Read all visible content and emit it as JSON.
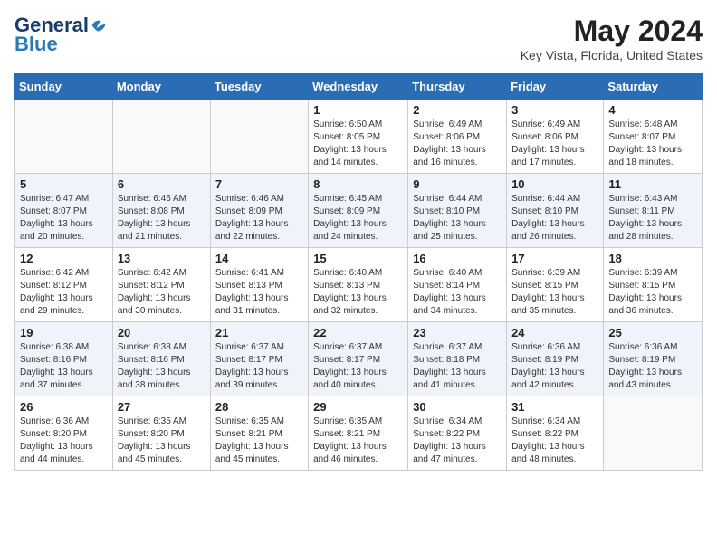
{
  "header": {
    "logo": {
      "general": "General",
      "blue": "Blue"
    },
    "title": "May 2024",
    "location": "Key Vista, Florida, United States"
  },
  "weekdays": [
    "Sunday",
    "Monday",
    "Tuesday",
    "Wednesday",
    "Thursday",
    "Friday",
    "Saturday"
  ],
  "weeks": [
    [
      {
        "day": "",
        "info": ""
      },
      {
        "day": "",
        "info": ""
      },
      {
        "day": "",
        "info": ""
      },
      {
        "day": "1",
        "info": "Sunrise: 6:50 AM\nSunset: 8:05 PM\nDaylight: 13 hours and 14 minutes."
      },
      {
        "day": "2",
        "info": "Sunrise: 6:49 AM\nSunset: 8:06 PM\nDaylight: 13 hours and 16 minutes."
      },
      {
        "day": "3",
        "info": "Sunrise: 6:49 AM\nSunset: 8:06 PM\nDaylight: 13 hours and 17 minutes."
      },
      {
        "day": "4",
        "info": "Sunrise: 6:48 AM\nSunset: 8:07 PM\nDaylight: 13 hours and 18 minutes."
      }
    ],
    [
      {
        "day": "5",
        "info": "Sunrise: 6:47 AM\nSunset: 8:07 PM\nDaylight: 13 hours and 20 minutes."
      },
      {
        "day": "6",
        "info": "Sunrise: 6:46 AM\nSunset: 8:08 PM\nDaylight: 13 hours and 21 minutes."
      },
      {
        "day": "7",
        "info": "Sunrise: 6:46 AM\nSunset: 8:09 PM\nDaylight: 13 hours and 22 minutes."
      },
      {
        "day": "8",
        "info": "Sunrise: 6:45 AM\nSunset: 8:09 PM\nDaylight: 13 hours and 24 minutes."
      },
      {
        "day": "9",
        "info": "Sunrise: 6:44 AM\nSunset: 8:10 PM\nDaylight: 13 hours and 25 minutes."
      },
      {
        "day": "10",
        "info": "Sunrise: 6:44 AM\nSunset: 8:10 PM\nDaylight: 13 hours and 26 minutes."
      },
      {
        "day": "11",
        "info": "Sunrise: 6:43 AM\nSunset: 8:11 PM\nDaylight: 13 hours and 28 minutes."
      }
    ],
    [
      {
        "day": "12",
        "info": "Sunrise: 6:42 AM\nSunset: 8:12 PM\nDaylight: 13 hours and 29 minutes."
      },
      {
        "day": "13",
        "info": "Sunrise: 6:42 AM\nSunset: 8:12 PM\nDaylight: 13 hours and 30 minutes."
      },
      {
        "day": "14",
        "info": "Sunrise: 6:41 AM\nSunset: 8:13 PM\nDaylight: 13 hours and 31 minutes."
      },
      {
        "day": "15",
        "info": "Sunrise: 6:40 AM\nSunset: 8:13 PM\nDaylight: 13 hours and 32 minutes."
      },
      {
        "day": "16",
        "info": "Sunrise: 6:40 AM\nSunset: 8:14 PM\nDaylight: 13 hours and 34 minutes."
      },
      {
        "day": "17",
        "info": "Sunrise: 6:39 AM\nSunset: 8:15 PM\nDaylight: 13 hours and 35 minutes."
      },
      {
        "day": "18",
        "info": "Sunrise: 6:39 AM\nSunset: 8:15 PM\nDaylight: 13 hours and 36 minutes."
      }
    ],
    [
      {
        "day": "19",
        "info": "Sunrise: 6:38 AM\nSunset: 8:16 PM\nDaylight: 13 hours and 37 minutes."
      },
      {
        "day": "20",
        "info": "Sunrise: 6:38 AM\nSunset: 8:16 PM\nDaylight: 13 hours and 38 minutes."
      },
      {
        "day": "21",
        "info": "Sunrise: 6:37 AM\nSunset: 8:17 PM\nDaylight: 13 hours and 39 minutes."
      },
      {
        "day": "22",
        "info": "Sunrise: 6:37 AM\nSunset: 8:17 PM\nDaylight: 13 hours and 40 minutes."
      },
      {
        "day": "23",
        "info": "Sunrise: 6:37 AM\nSunset: 8:18 PM\nDaylight: 13 hours and 41 minutes."
      },
      {
        "day": "24",
        "info": "Sunrise: 6:36 AM\nSunset: 8:19 PM\nDaylight: 13 hours and 42 minutes."
      },
      {
        "day": "25",
        "info": "Sunrise: 6:36 AM\nSunset: 8:19 PM\nDaylight: 13 hours and 43 minutes."
      }
    ],
    [
      {
        "day": "26",
        "info": "Sunrise: 6:36 AM\nSunset: 8:20 PM\nDaylight: 13 hours and 44 minutes."
      },
      {
        "day": "27",
        "info": "Sunrise: 6:35 AM\nSunset: 8:20 PM\nDaylight: 13 hours and 45 minutes."
      },
      {
        "day": "28",
        "info": "Sunrise: 6:35 AM\nSunset: 8:21 PM\nDaylight: 13 hours and 45 minutes."
      },
      {
        "day": "29",
        "info": "Sunrise: 6:35 AM\nSunset: 8:21 PM\nDaylight: 13 hours and 46 minutes."
      },
      {
        "day": "30",
        "info": "Sunrise: 6:34 AM\nSunset: 8:22 PM\nDaylight: 13 hours and 47 minutes."
      },
      {
        "day": "31",
        "info": "Sunrise: 6:34 AM\nSunset: 8:22 PM\nDaylight: 13 hours and 48 minutes."
      },
      {
        "day": "",
        "info": ""
      }
    ]
  ]
}
